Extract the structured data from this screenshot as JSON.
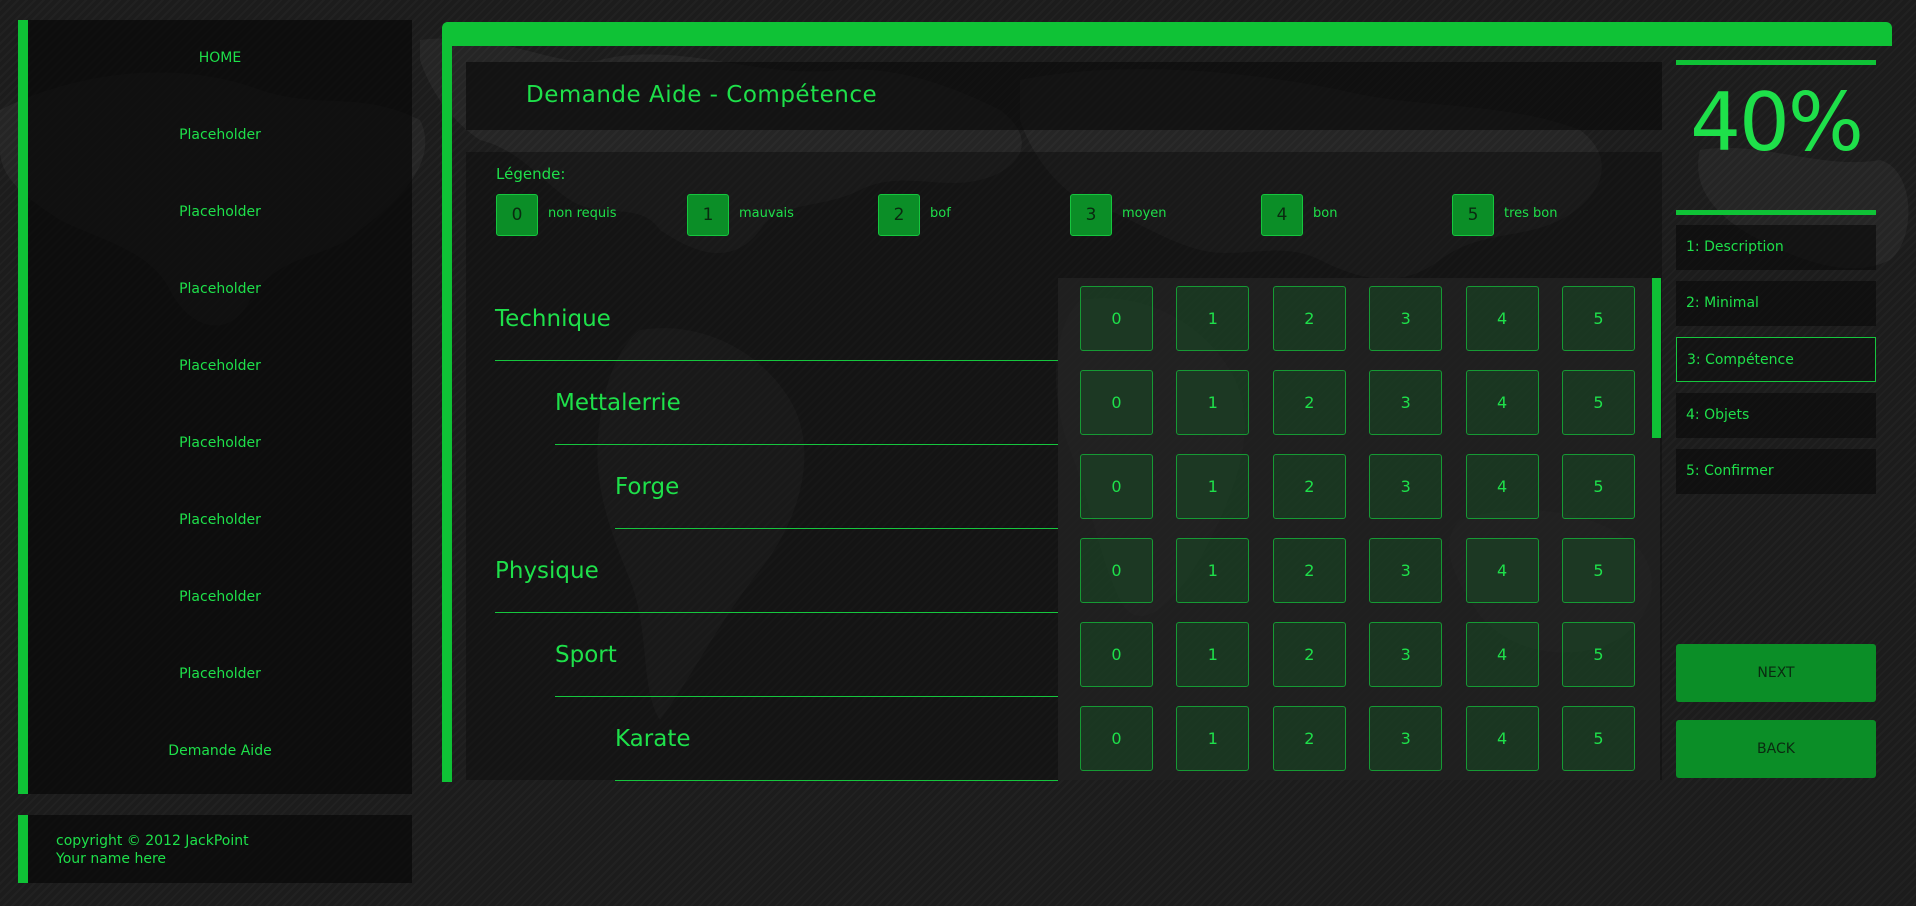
{
  "sidebar": {
    "items": [
      {
        "label": "HOME"
      },
      {
        "label": "Placeholder"
      },
      {
        "label": "Placeholder"
      },
      {
        "label": "Placeholder"
      },
      {
        "label": "Placeholder"
      },
      {
        "label": "Placeholder"
      },
      {
        "label": "Placeholder"
      },
      {
        "label": "Placeholder"
      },
      {
        "label": "Placeholder"
      },
      {
        "label": "Demande Aide"
      }
    ]
  },
  "footer": {
    "copyright": "copyright © 2012 JackPoint",
    "name": "Your name here"
  },
  "main": {
    "title": "Demande Aide - Compétence",
    "legend_title": "Légende:",
    "legend": [
      {
        "value": "0",
        "label": "non requis"
      },
      {
        "value": "1",
        "label": "mauvais"
      },
      {
        "value": "2",
        "label": "bof"
      },
      {
        "value": "3",
        "label": "moyen"
      },
      {
        "value": "4",
        "label": "bon"
      },
      {
        "value": "5",
        "label": "tres bon"
      }
    ],
    "skills": [
      {
        "name": "Technique",
        "level": 0
      },
      {
        "name": "Mettalerrie",
        "level": 1
      },
      {
        "name": "Forge",
        "level": 2
      },
      {
        "name": "Physique",
        "level": 0
      },
      {
        "name": "Sport",
        "level": 1
      },
      {
        "name": "Karate",
        "level": 2
      }
    ],
    "ratings": [
      "0",
      "1",
      "2",
      "3",
      "4",
      "5"
    ]
  },
  "progress": {
    "label": "40%"
  },
  "steps": [
    {
      "label": "1: Description",
      "active": false
    },
    {
      "label": "2: Minimal",
      "active": false
    },
    {
      "label": "3: Compétence",
      "active": true
    },
    {
      "label": "4: Objets",
      "active": false
    },
    {
      "label": "5: Confirmer",
      "active": false
    }
  ],
  "buttons": {
    "next": "NEXT",
    "back": "BACK"
  },
  "colors": {
    "accent": "#0fc236",
    "text": "#1ee04a",
    "button": "#0b8e27"
  }
}
